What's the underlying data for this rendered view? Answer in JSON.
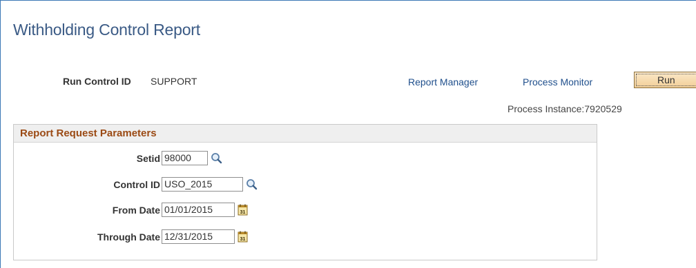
{
  "page": {
    "title": "Withholding Control Report"
  },
  "run_control": {
    "label": "Run Control ID",
    "value": "SUPPORT"
  },
  "links": {
    "report_manager": "Report Manager",
    "process_monitor": "Process Monitor"
  },
  "run_button": {
    "label": "Run"
  },
  "process_instance": {
    "text": "Process Instance:7920529"
  },
  "parameters": {
    "header": "Report Request Parameters",
    "fields": [
      {
        "label": "Setid",
        "value": "98000",
        "icon": "lookup-icon"
      },
      {
        "label": "Control ID",
        "value": "USO_2015",
        "icon": "lookup-icon"
      },
      {
        "label": "From Date",
        "value": "01/01/2015",
        "icon": "calendar-icon"
      },
      {
        "label": "Through Date",
        "value": "12/31/2015",
        "icon": "calendar-icon"
      }
    ]
  },
  "colors": {
    "title": "#3a5a85",
    "link": "#1f4f8c",
    "group_header_text": "#9b4a14",
    "run_button_bg": "#f2cf98"
  }
}
